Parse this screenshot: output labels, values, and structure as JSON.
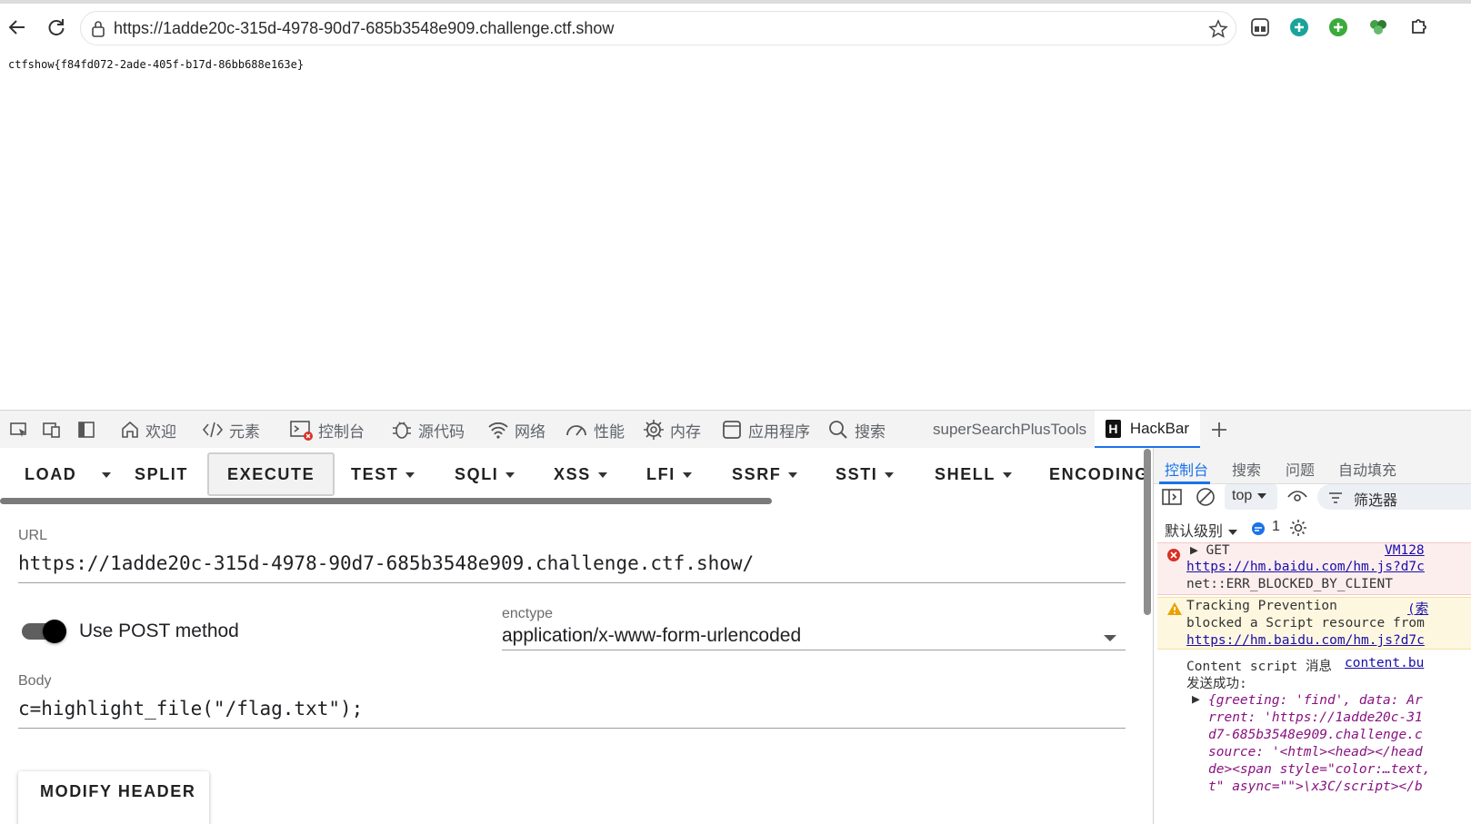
{
  "browser": {
    "url": "https://1adde20c-315d-4978-90d7-685b3548e909.challenge.ctf.show"
  },
  "page": {
    "flag_text": "ctfshow{f84fd072-2ade-405f-b17d-86bb688e163e}"
  },
  "devtools": {
    "tabs": {
      "welcome": "欢迎",
      "elements": "元素",
      "console": "控制台",
      "sources": "源代码",
      "network": "网络",
      "performance": "性能",
      "memory": "内存",
      "application": "应用程序",
      "search": "搜索",
      "super_search": "superSearchPlusTools",
      "hackbar": "HackBar"
    }
  },
  "hackbar": {
    "toolbar": {
      "load": "LOAD",
      "split": "SPLIT",
      "execute": "EXECUTE",
      "test": "TEST",
      "sqli": "SQLI",
      "xss": "XSS",
      "lfi": "LFI",
      "ssrf": "SSRF",
      "ssti": "SSTI",
      "shell": "SHELL",
      "encoding": "ENCODING"
    },
    "url_label": "URL",
    "url_value": "https://1adde20c-315d-4978-90d7-685b3548e909.challenge.ctf.show/",
    "post_label": "Use POST method",
    "post_enabled": true,
    "enctype_label": "enctype",
    "enctype_value": "application/x-www-form-urlencoded",
    "body_label": "Body",
    "body_value": "c=highlight_file(\"/flag.txt\");",
    "modify_header": "MODIFY HEADER"
  },
  "console_panel": {
    "tabs": {
      "console": "控制台",
      "search": "搜索",
      "issues": "问题",
      "autofill": "自动填充"
    },
    "context": "top",
    "filter": "筛选器",
    "level": "默认级别",
    "message_count": "1",
    "error": {
      "method": "GET",
      "source": "VM128",
      "url": "https://hm.baidu.com/hm.js?d7c",
      "message": "net::ERR_BLOCKED_BY_CLIENT"
    },
    "warning": {
      "line1": "Tracking Prevention",
      "source": "(索",
      "line2": "blocked a Script resource from",
      "url": "https://hm.baidu.com/hm.js?d7c"
    },
    "info": {
      "line1": "Content script 消息",
      "source": "content.bu",
      "line2": "发送成功:",
      "obj_lines": [
        "{greeting: 'find', data: Ar",
        "rrent: 'https://1adde20c-31",
        "d7-685b3548e909.challenge.c",
        "source: '<html><head></head",
        "de><span style=\"color:…text,",
        "t\" async=\"\">\\x3C/script></b"
      ]
    }
  }
}
